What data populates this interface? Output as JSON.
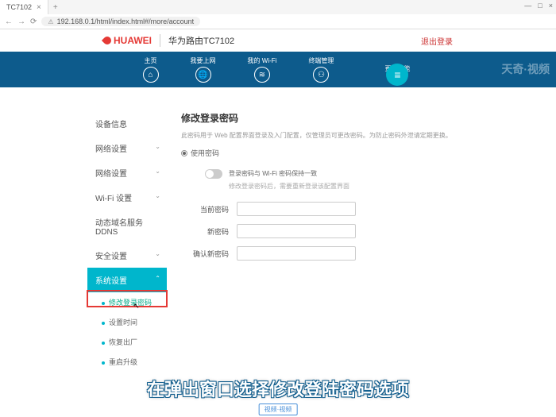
{
  "browser": {
    "tab_title": "TC7102",
    "url": "192.168.0.1/html/index.html#/more/account",
    "window_controls": [
      "—",
      "□",
      "×"
    ]
  },
  "header": {
    "brand": "HUAWEI",
    "model": "华为路由TC7102",
    "right_link": "退出登录"
  },
  "nav": {
    "items": [
      {
        "label": "主页",
        "icon": "⌂"
      },
      {
        "label": "我要上网",
        "icon": "🌐"
      },
      {
        "label": "我的 Wi-Fi",
        "icon": "≋"
      },
      {
        "label": "终端管理",
        "icon": "⚇"
      }
    ],
    "more_label": "更多功能",
    "more_icon": "≡"
  },
  "sidebar": {
    "items": [
      {
        "label": "设备信息"
      },
      {
        "label": "网络设置"
      },
      {
        "label": "网络设置"
      },
      {
        "label": "Wi-Fi 设置"
      },
      {
        "label": "动态域名服务 DDNS"
      },
      {
        "label": "安全设置"
      },
      {
        "label": "系统设置",
        "active": true
      }
    ],
    "subs": [
      {
        "label": "修改登录密码",
        "current": true
      },
      {
        "label": "设置时间"
      },
      {
        "label": "恢复出厂"
      },
      {
        "label": "重启升级"
      }
    ]
  },
  "panel": {
    "title": "修改登录密码",
    "desc": "此密码用于 Web 配置界面登录及入门配置，仅管理员可更改密码。为防止密码外泄请定期更换。",
    "radio_label": "使用密码",
    "toggle_label": "登录密码与 Wi-Fi 密码保持一致",
    "toggle_sub": "修改登录密码后，需要重新登录该配置界面",
    "fields": {
      "cur_label": "当前密码",
      "new_label": "新密码",
      "confirm_label": "确认新密码"
    }
  },
  "overlay": {
    "subtitle": "在弹出窗口选择修改登陆密码选项",
    "widget": "视频·视频"
  },
  "watermark": "天奇·视频"
}
